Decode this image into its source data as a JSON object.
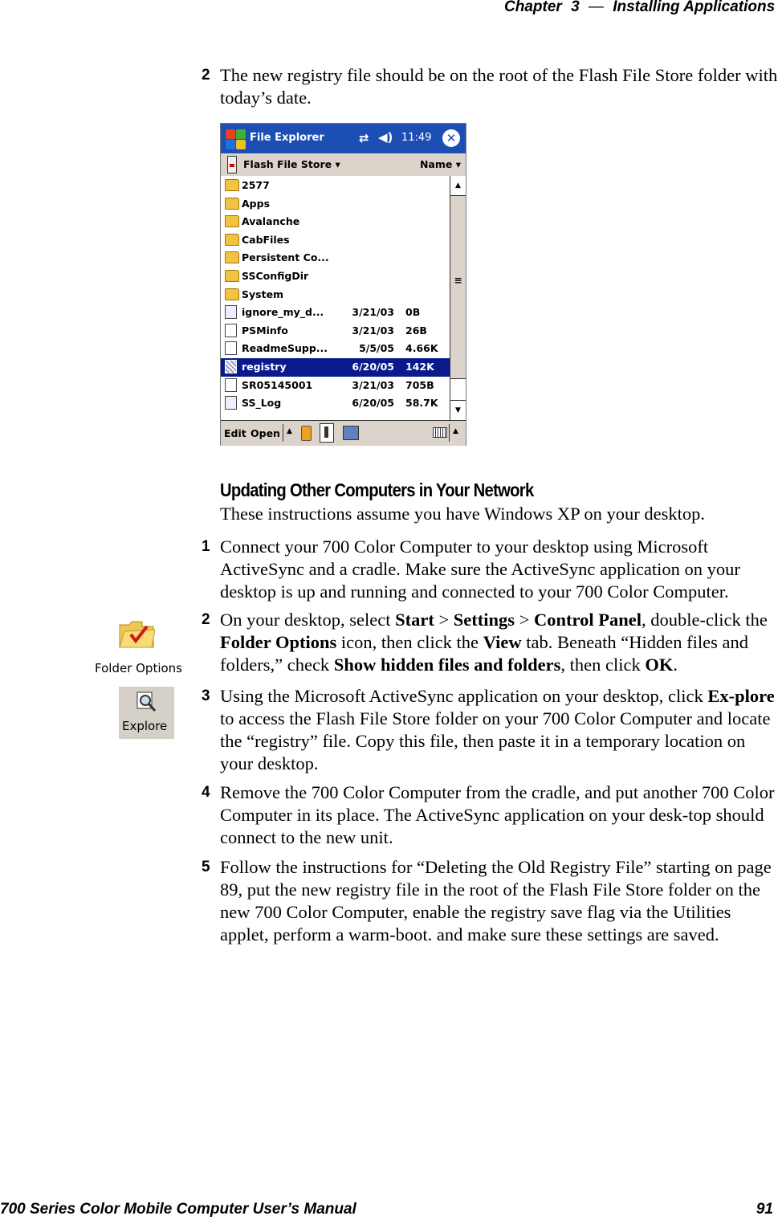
{
  "header": {
    "chapter": "Chapter",
    "chapter_num": "3",
    "dash": "—",
    "title": "Installing Applications"
  },
  "intro_step": {
    "num": "2",
    "text": "The new registry file should be on the root of the Flash File Store folder with today’s date."
  },
  "screenshot": {
    "title": "File Explorer",
    "clock": "11:49",
    "signal_icon": "connectivity-icon",
    "volume_icon": "speaker-icon",
    "close_label": "✕",
    "location": "Flash File Store ▾",
    "sort": "Name ▾",
    "files": [
      {
        "name": "2577",
        "type": "folder",
        "date": "",
        "size": ""
      },
      {
        "name": "Apps",
        "type": "folder",
        "date": "",
        "size": ""
      },
      {
        "name": "Avalanche",
        "type": "folder",
        "date": "",
        "size": ""
      },
      {
        "name": "CabFiles",
        "type": "folder",
        "date": "",
        "size": ""
      },
      {
        "name": "Persistent Co...",
        "type": "folder",
        "date": "",
        "size": ""
      },
      {
        "name": "SSConfigDir",
        "type": "folder",
        "date": "",
        "size": ""
      },
      {
        "name": "System",
        "type": "folder",
        "date": "",
        "size": ""
      },
      {
        "name": "ignore_my_d...",
        "type": "exe",
        "date": "3/21/03",
        "size": "0B"
      },
      {
        "name": "PSMinfo",
        "type": "doc",
        "date": "3/21/03",
        "size": "26B"
      },
      {
        "name": "ReadmeSupp...",
        "type": "doc",
        "date": "5/5/05",
        "size": "4.66K"
      },
      {
        "name": "registry",
        "type": "reg",
        "date": "6/20/05",
        "size": "142K",
        "selected": true
      },
      {
        "name": "SR05145001",
        "type": "doc",
        "date": "3/21/03",
        "size": "705B"
      },
      {
        "name": "SS_Log",
        "type": "exe",
        "date": "6/20/05",
        "size": "58.7K"
      }
    ],
    "menu_edit": "Edit",
    "menu_open": "Open",
    "scroll_up": "▲",
    "scroll_down": "▼",
    "grip": "≡",
    "caret": "▲"
  },
  "section": {
    "heading": "Updating Other Computers in Your Network",
    "intro": "These instructions assume you have Windows XP on your desktop."
  },
  "steps": [
    {
      "num": "1",
      "html": "Connect your 700 Color Computer to your desktop using Microsoft ActiveSync and a cradle. Make sure the ActiveSync application on your desktop is up and running and connected to your 700 Color Computer."
    },
    {
      "num": "2",
      "html": "On your desktop, select <b>Start</b> &gt; <b>Settings</b> &gt; <b>Control Panel</b>, double-click the <b>Folder Options</b> icon, then click the <b>View</b> tab. Beneath “Hidden files and folders,” check <b>Show hidden files and folders</b>, then click <b>OK</b>."
    },
    {
      "num": "3",
      "html": "Using the Microsoft ActiveSync application on your desktop, click <b>Ex-plore</b> to access the Flash File Store folder on your 700 Color Computer and locate the “registry” file. Copy this file, then paste it in a temporary location on your desktop."
    },
    {
      "num": "4",
      "html": "Remove the 700 Color Computer from the cradle, and put another 700 Color Computer in its place. The ActiveSync application on your desk-top should connect to the new unit."
    },
    {
      "num": "5",
      "html": "Follow the instructions for “Deleting the Old Registry File” starting on page 89, put the new registry file in the root of the Flash File Store folder on the new 700 Color Computer, enable the registry save flag via the Utilities applet, perform a warm-boot. and make sure these settings are saved."
    }
  ],
  "margin_icons": {
    "folder_options": "Folder Options",
    "explore": "Explore"
  },
  "footer": {
    "manual": "700 Series Color Mobile Computer User’s Manual",
    "page": "91"
  }
}
